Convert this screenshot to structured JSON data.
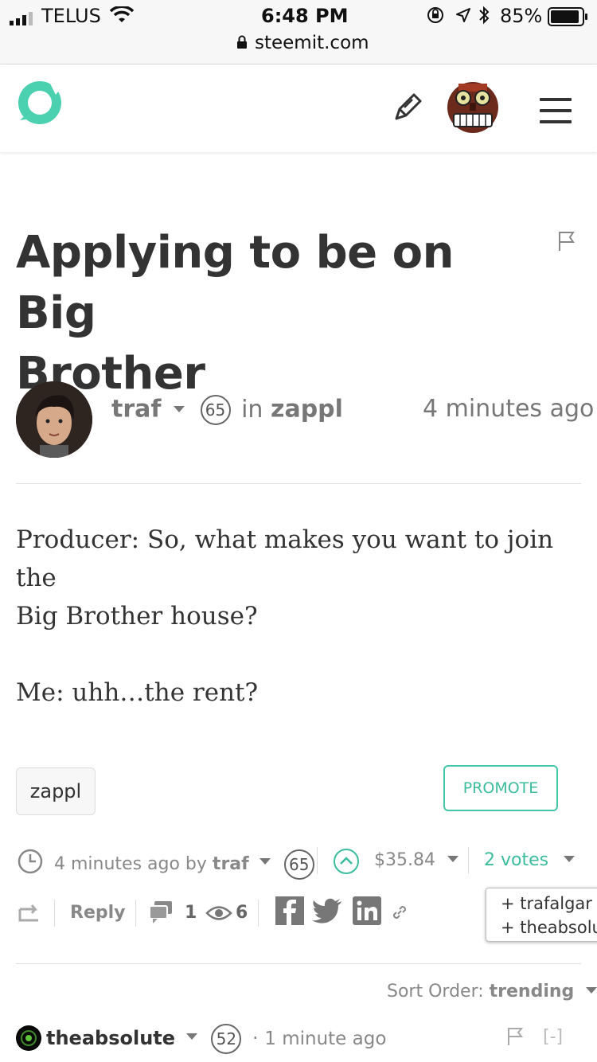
{
  "status_bar": {
    "carrier": "TELUS",
    "time": "6:48 PM",
    "battery": "85%",
    "url": "steemit.com"
  },
  "post": {
    "title_line1": "Applying to be on Big",
    "title_line2": "Brother",
    "author": "traf",
    "author_reputation": "65",
    "in_label": "in",
    "community": "zappl",
    "time_ago": "4 minutes ago",
    "body_line1": "Producer: So, what makes you want to join the",
    "body_line2": "Big Brother house?",
    "body_line3": "Me: uhh…the rent?",
    "tag": "zappl",
    "promote_label": "PROMOTE"
  },
  "footer": {
    "time_by": "4 minutes ago by",
    "author": "traf",
    "reputation": "65",
    "payout": "$35.84",
    "votes": "2 votes",
    "reply_label": "Reply",
    "comment_count": "1",
    "view_count": "6",
    "voters": [
      "+ trafalgar",
      "+ theabsolute"
    ]
  },
  "comments": {
    "sort_label": "Sort Order:",
    "sort_value": "trending",
    "first_author": "theabsolute",
    "first_reputation": "52",
    "first_time": "1 minute ago",
    "collapse_label": "[-]"
  },
  "colors": {
    "accent": "#43c6a9",
    "upvote": "#3bbd9e",
    "text": "#333333"
  }
}
